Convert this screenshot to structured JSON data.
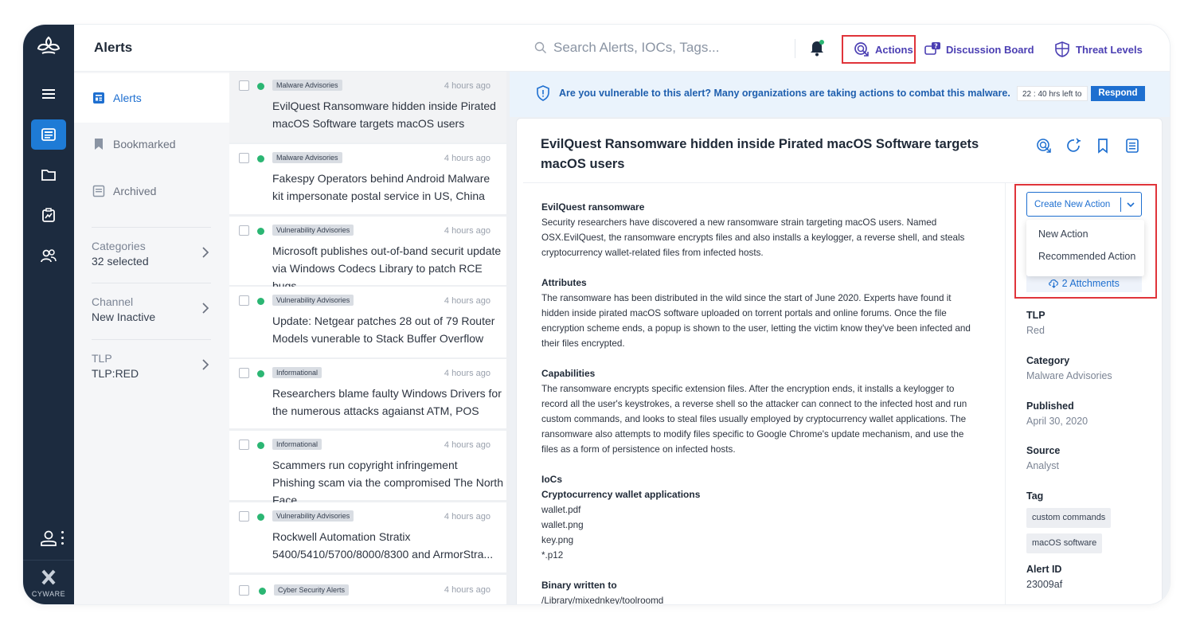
{
  "header": {
    "title": "Alerts",
    "search_placeholder": "Search Alerts, IOCs, Tags...",
    "actions_label": "Actions",
    "discussion_label": "Discussion Board",
    "threat_label": "Threat Levels"
  },
  "rail": {
    "brand": "CYWARE"
  },
  "subnav": {
    "items": [
      {
        "label": "Alerts"
      },
      {
        "label": "Bookmarked"
      },
      {
        "label": "Archived"
      }
    ],
    "filters": [
      {
        "label": "Categories",
        "value": "32 selected"
      },
      {
        "label": "Channel",
        "value": "New Inactive"
      },
      {
        "label": "TLP",
        "value": "TLP:RED"
      }
    ]
  },
  "alerts": [
    {
      "tag": "Malware Advisories",
      "time": "4 hours ago",
      "title": "EvilQuest Ransomware hidden inside Pirated macOS Software targets macOS users"
    },
    {
      "tag": "Malware Advisories",
      "time": "4 hours ago",
      "title": "Fakespy Operators behind Android Malware kit impersonate postal service in US, China"
    },
    {
      "tag": "Vulnerability Advisories",
      "time": "4 hours ago",
      "title": "Microsoft publishes out-of-band securit update via Windows Codecs Library to patch RCE bugs"
    },
    {
      "tag": "Vulnerability Advisories",
      "time": "4 hours ago",
      "title": "Update: Netgear patches 28 out of 79 Router Models vunerable to Stack Buffer Overflow"
    },
    {
      "tag": "Informational",
      "time": "4 hours ago",
      "title": "Researchers blame faulty Windows Drivers for the numerous attacks agaianst ATM, POS"
    },
    {
      "tag": "Informational",
      "time": "4 hours ago",
      "title": "Scammers run copyright infringement Phishing scam via the compromised The North Face"
    },
    {
      "tag": "Vulnerability Advisories",
      "time": "4 hours ago",
      "title": "Rockwell Automation Stratix 5400/5410/5700/8000/8300 and ArmorStra..."
    },
    {
      "tag": "Cyber Security Alerts",
      "time": "4 hours ago",
      "title": ""
    }
  ],
  "banner": {
    "message": "Are you vulnerable to this alert? Many organizations are taking actions to combat this malware.",
    "timer": "22 : 40 hrs left to",
    "respond": "Respond"
  },
  "detail": {
    "title": "EvilQuest Ransomware hidden inside Pirated macOS Software targets macOS users",
    "s1_head": "EvilQuest ransomware",
    "s1_body": "Security researchers have discovered a new ransomware strain targeting macOS users. Named OSX.EvilQuest, the ransomware encrypts files and also installs a keylogger, a reverse shell, and steals cryptocurrency wallet-related files from infected hosts.",
    "s2_head": "Attributes",
    "s2_body": "The ransomware has been distributed in the wild since the start of June 2020. Experts have found it hidden inside pirated macOS software uploaded on torrent portals and online forums. Once the file encryption scheme ends, a popup is shown to the user, letting the victim know they've been infected and their files encrypted.",
    "s3_head": "Capabilities",
    "s3_body": "The ransomware encrypts specific extension files. After the encryption ends, it installs a keylogger to record all the user's keystrokes, a reverse shell so the attacker can connect to the infected host and run custom commands, and looks to steal files usually employed by cryptocurrency wallet applications. The ransomware also attempts to modify files specific to Google Chrome's update mechanism, and use the files as a form of persistence on infected hosts.",
    "s4_head": "IoCs",
    "s4_sub": "Cryptocurrency wallet applications",
    "iocs": [
      "wallet.pdf",
      "wallet.png",
      "key.png",
      "*.p12"
    ],
    "s5_head": "Binary written to",
    "s5_body": "/Library/mixednkey/toolroomd"
  },
  "side": {
    "create_action": "Create New Action",
    "options": [
      "New Action",
      "Recommended Action"
    ],
    "attachments": "2 Attchments",
    "tlp_label": "TLP",
    "tlp_value": "Red",
    "category_label": "Category",
    "category_value": "Malware Advisories",
    "published_label": "Published",
    "published_value": "April 30, 2020",
    "source_label": "Source",
    "source_value": "Analyst",
    "tag_label": "Tag",
    "tags": [
      "custom commands",
      "macOS software"
    ],
    "alert_id_label": "Alert ID",
    "alert_id_value": "23009af"
  },
  "colors": {
    "rail": "#1c2b3f",
    "accent": "#1e6fd0",
    "highlight": "#e0343a",
    "status": "#2bb673"
  }
}
